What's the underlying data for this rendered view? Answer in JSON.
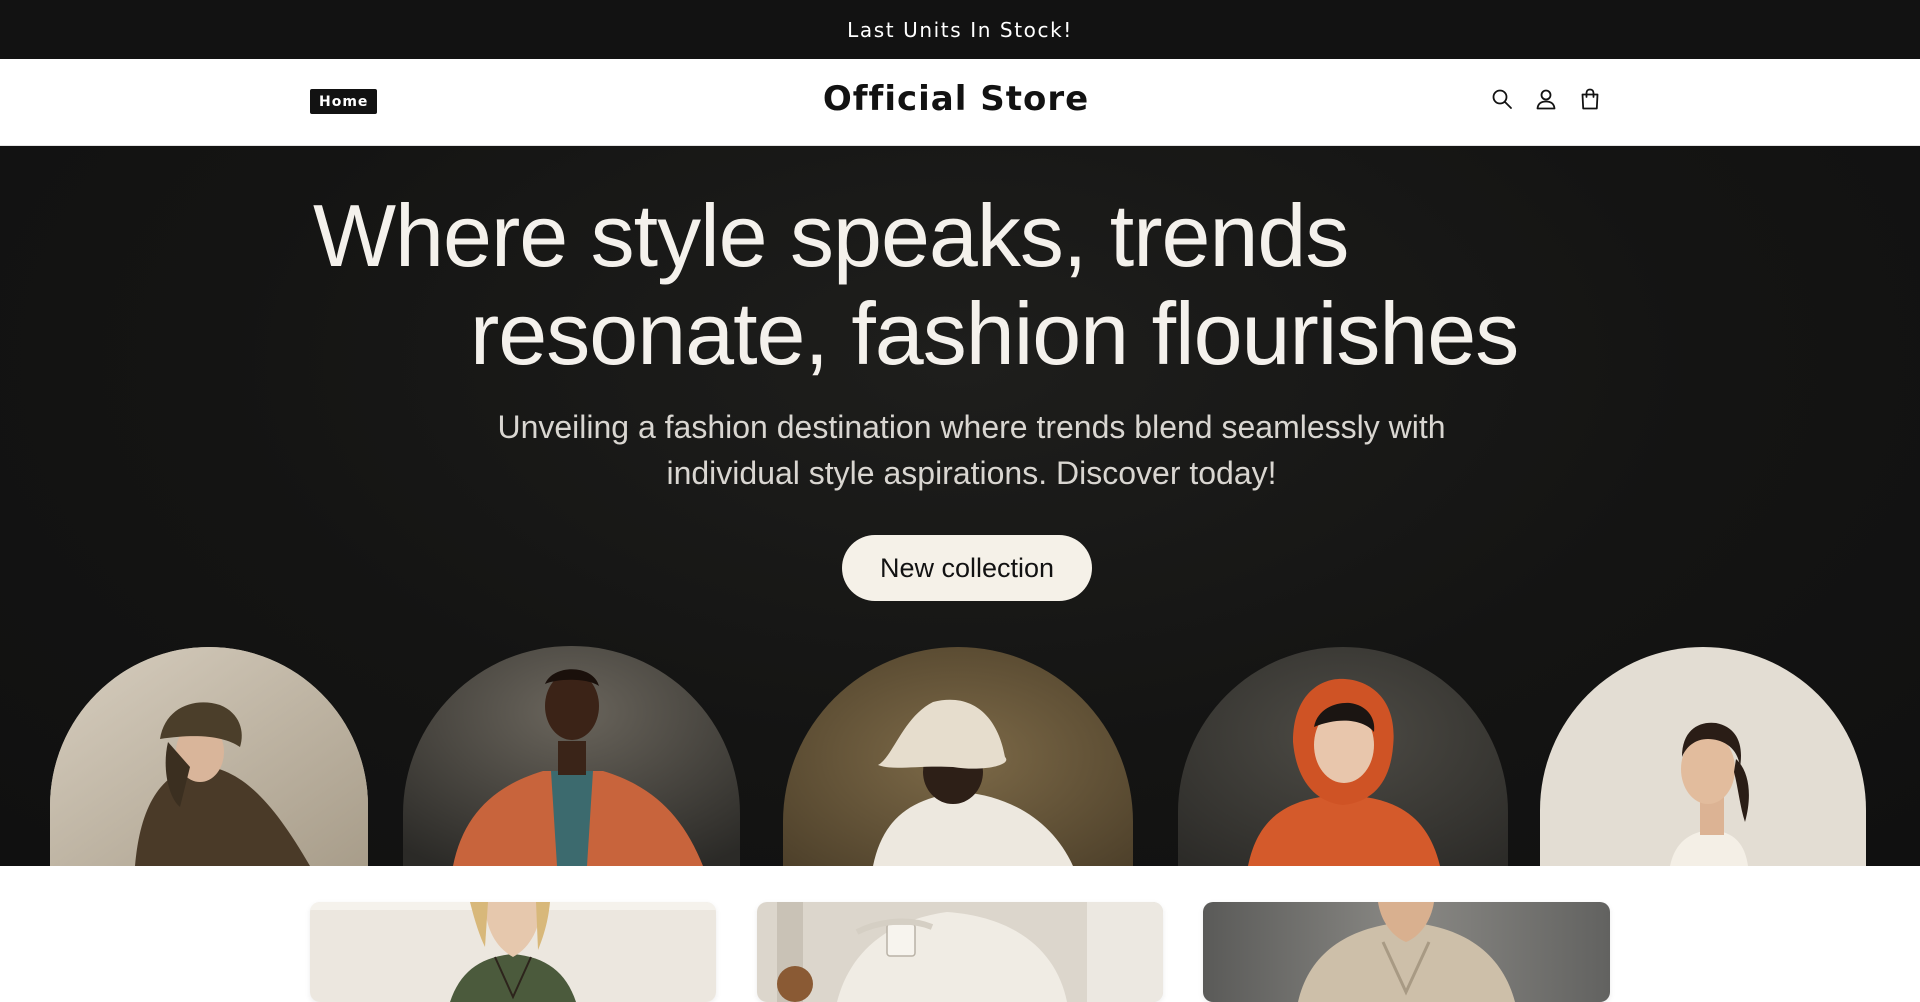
{
  "announcement": {
    "text": "Last Units In Stock!"
  },
  "header": {
    "nav_home": "Home",
    "logo": "Official Store",
    "icons": [
      "search-icon",
      "account-icon",
      "cart-icon"
    ]
  },
  "hero": {
    "title_line1": "Where style speaks, trends",
    "title_line2": "resonate, fashion flourishes",
    "subtitle_line1": "Unveiling a fashion destination where trends blend seamlessly with",
    "subtitle_line2": "individual style aspirations. Discover today!",
    "button_label": "New collection",
    "portraits": [
      "woman-in-brown-hat-and-coat",
      "man-in-orange-blazer",
      "person-in-bucket-hat",
      "woman-in-orange-hoodie",
      "woman-with-ponytail"
    ]
  },
  "cards": [
    "woman-in-green-top",
    "person-in-knit-sweater-with-mug",
    "person-in-beige-cardigan"
  ],
  "colors": {
    "announcement_bg": "#121212",
    "hero_bg": "#131312",
    "button_bg": "#f5f1e8",
    "text_light": "#f4f1ec"
  }
}
